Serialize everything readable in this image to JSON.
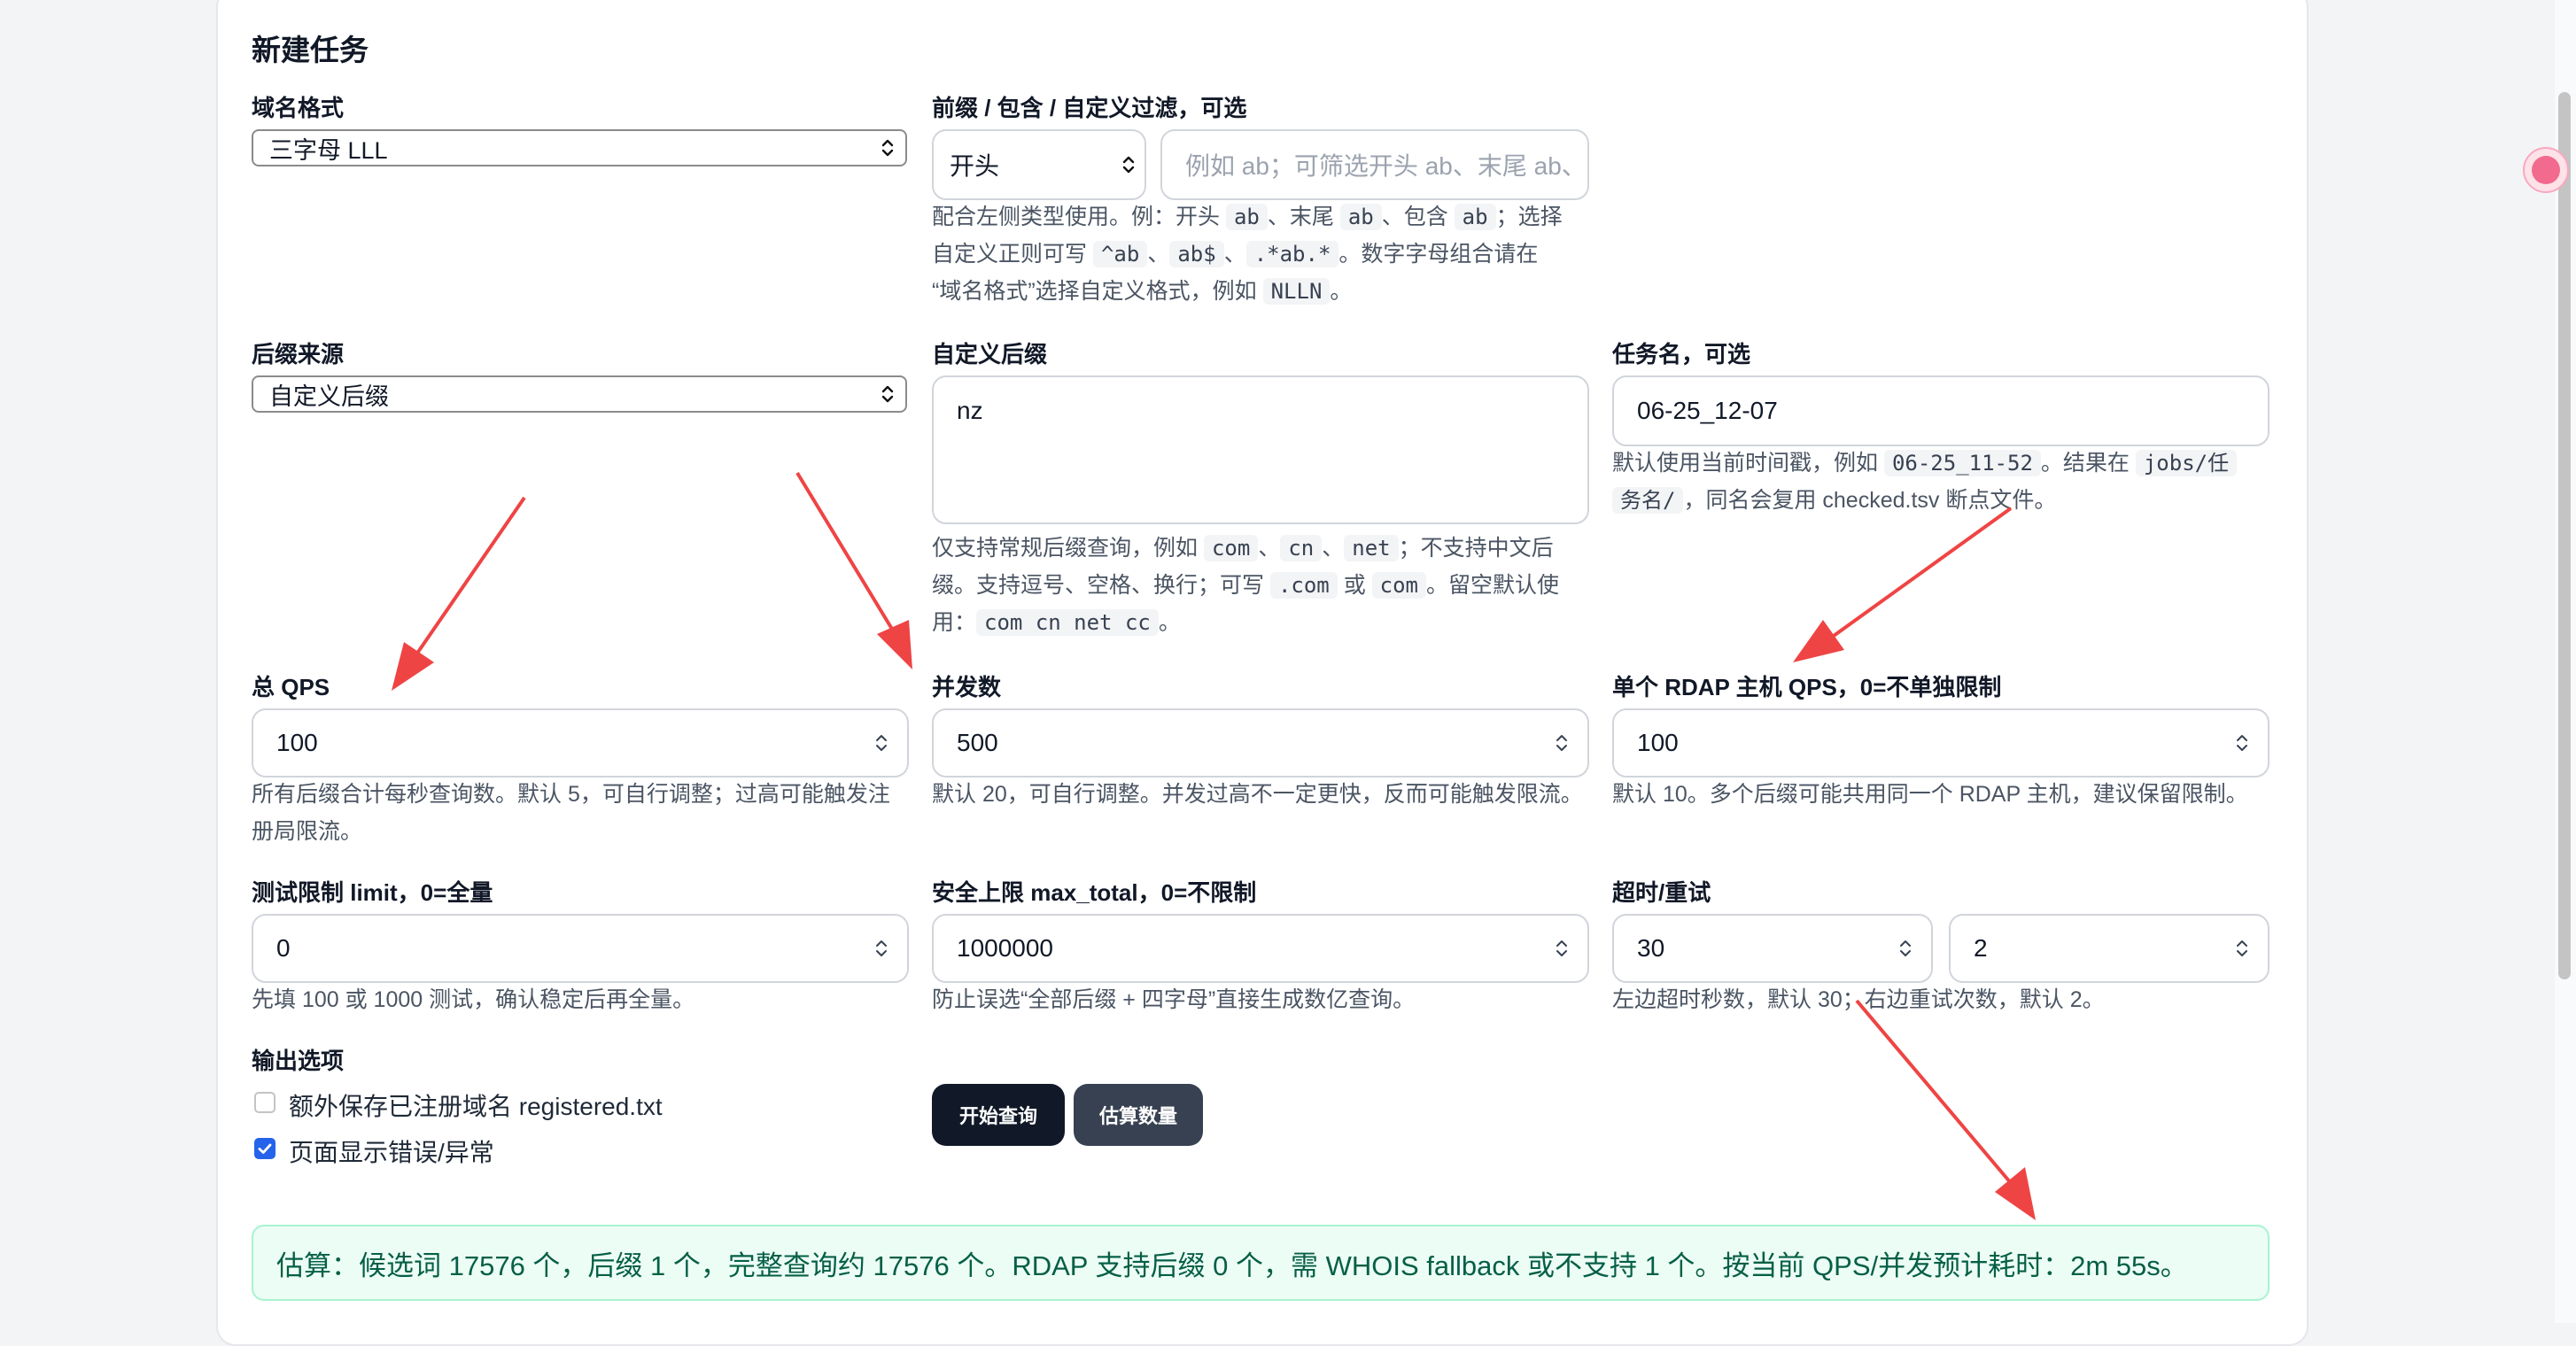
{
  "page_title": "新建任务",
  "domain_format": {
    "label": "域名格式",
    "value": "三字母 LLL"
  },
  "filter": {
    "label": "前缀 / 包含 / 自定义过滤，可选",
    "type_value": "开头",
    "placeholder": "例如 ab；可筛选开头 ab、末尾 ab、",
    "help": {
      "t1": "配合左侧类型使用。例：开头 ",
      "c1": "ab",
      "t2": "、末尾 ",
      "c2": "ab",
      "t3": "、包含 ",
      "c3": "ab",
      "t4": "；选择",
      "t5": "自定义正则可写 ",
      "c4": "^ab",
      "t6": "、",
      "c5": "ab$",
      "t7": "、",
      "c6": ".*ab.*",
      "t8": "。数字字母组合请在",
      "t9": "“域名格式”选择自定义格式，例如 ",
      "c7": "NLLN",
      "t10": "。"
    }
  },
  "suffix_source": {
    "label": "后缀来源",
    "value": "自定义后缀"
  },
  "custom_suffix": {
    "label": "自定义后缀",
    "value": "nz",
    "help": {
      "t1": "仅支持常规后缀查询，例如 ",
      "c1": "com",
      "t2": "、",
      "c2": "cn",
      "t3": "、",
      "c3": "net",
      "t4": "；不支持中文后",
      "t5": "缀。支持逗号、空格、换行；可写 ",
      "c4": ".com",
      "t6": " 或 ",
      "c5": "com",
      "t7": "。留空默认使",
      "t8": "用：",
      "c6": "com cn net cc",
      "t9": "。"
    }
  },
  "task_name": {
    "label": "任务名，可选",
    "value": "06-25_12-07",
    "help": {
      "t1": "默认使用当前时间戳，例如 ",
      "c1": "06-25_11-52",
      "t2": "。结果在 ",
      "c2": "jobs/任",
      "c3": "务名/",
      "t3": "，同名会复用 checked.tsv 断点文件。"
    }
  },
  "total_qps": {
    "label": "总 QPS",
    "value": "100",
    "help1": "所有后缀合计每秒查询数。默认 5，可自行调整；过高可能触发注",
    "help2": "册局限流。"
  },
  "concurrency": {
    "label": "并发数",
    "value": "500",
    "help": "默认 20，可自行调整。并发过高不一定更快，反而可能触发限流。"
  },
  "host_qps": {
    "label": "单个 RDAP 主机 QPS，0=不单独限制",
    "value": "100",
    "help": "默认 10。多个后缀可能共用同一个 RDAP 主机，建议保留限制。"
  },
  "test_limit": {
    "label": "测试限制 limit，0=全量",
    "value": "0",
    "help": "先填 100 或 1000 测试，确认稳定后再全量。"
  },
  "max_total": {
    "label": "安全上限 max_total，0=不限制",
    "value": "1000000",
    "help": "防止误选“全部后缀 + 四字母”直接生成数亿查询。"
  },
  "timeout_retry": {
    "label": "超时/重试",
    "timeout": "30",
    "retry": "2",
    "help": "左边超时秒数，默认 30；右边重试次数，默认 2。"
  },
  "output": {
    "label": "输出选项",
    "opt1": {
      "label": "额外保存已注册域名 registered.txt",
      "checked": false
    },
    "opt2": {
      "label": "页面显示错误/异常",
      "checked": true
    }
  },
  "buttons": {
    "start": "开始查询",
    "estimate": "估算数量"
  },
  "estimate_text": "估算：候选词 17576 个，后缀 1 个，完整查询约 17576 个。RDAP 支持后缀 0 个，需 WHOIS fallback 或不支持 1 个。按当前 QPS/并发预计耗时：2m 55s。",
  "colors": {
    "primary_button": "#111827",
    "secondary_button": "#374151",
    "checkbox_checked": "#2563eb",
    "estimate_bg": "#ecfdf5",
    "estimate_text": "#065f46",
    "annotation_arrow": "#ef4444"
  }
}
